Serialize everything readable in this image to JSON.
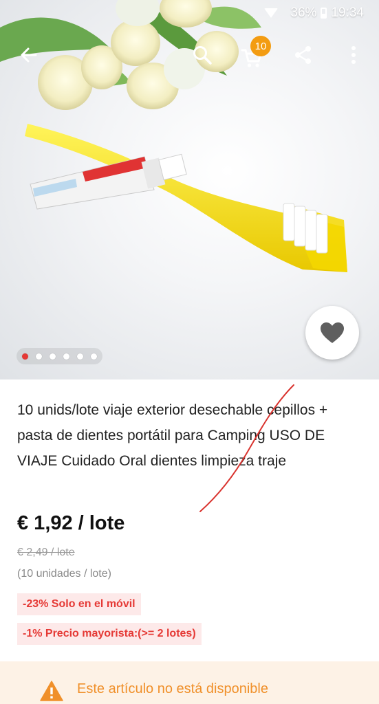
{
  "status_bar": {
    "battery": "36%",
    "time": "19:34",
    "icons": [
      "wifi-icon",
      "signal-icon",
      "battery-icon"
    ]
  },
  "toolbar": {
    "icons": [
      "back-arrow-icon",
      "search-icon",
      "cart-icon",
      "share-icon",
      "more-vert-icon"
    ],
    "cart_count": "10"
  },
  "gallery": {
    "image_count": 6,
    "active_index": 0
  },
  "product": {
    "title": "10 unids/lote viaje exterior desechable cepillos + pasta de dientes portátil para Camping USO DE VIAJE Cuidado Oral dientes limpieza traje",
    "price": "€ 1,92 / lote",
    "original_price": "€ 2,49 / lote",
    "units": "(10 unidades / lote)",
    "tags": {
      "mobile": "-23% Solo en el móvil",
      "wholesale": "-1% Precio mayorista:(>= 2 lotes)"
    }
  },
  "notice": {
    "text": "Este artículo no está disponible",
    "icon": "warning-icon"
  },
  "colors": {
    "accent_red": "#e53935",
    "badge_orange": "#f39c12",
    "warning_orange": "#f0902a"
  }
}
